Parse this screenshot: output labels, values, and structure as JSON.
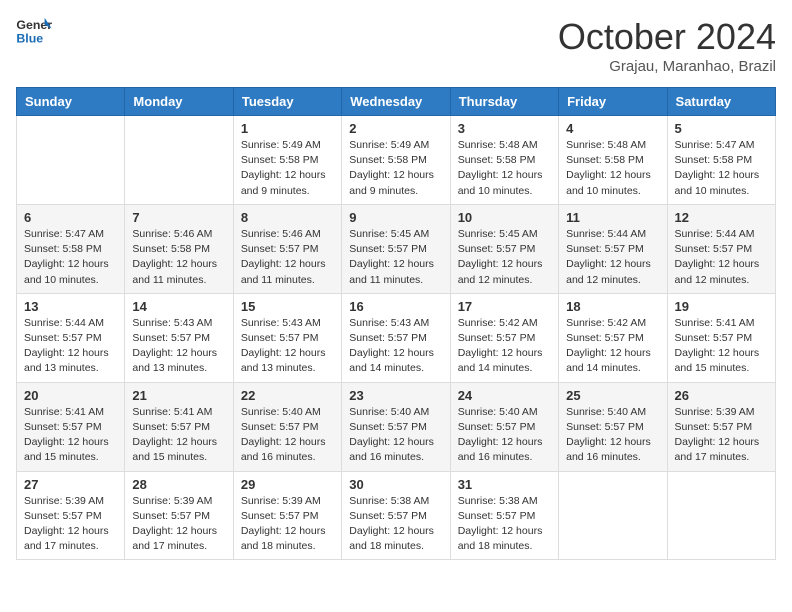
{
  "header": {
    "logo_line1": "General",
    "logo_line2": "Blue",
    "month": "October 2024",
    "location": "Grajau, Maranhao, Brazil"
  },
  "days_of_week": [
    "Sunday",
    "Monday",
    "Tuesday",
    "Wednesday",
    "Thursday",
    "Friday",
    "Saturday"
  ],
  "weeks": [
    [
      {
        "day": "",
        "info": ""
      },
      {
        "day": "",
        "info": ""
      },
      {
        "day": "1",
        "info": "Sunrise: 5:49 AM\nSunset: 5:58 PM\nDaylight: 12 hours and 9 minutes."
      },
      {
        "day": "2",
        "info": "Sunrise: 5:49 AM\nSunset: 5:58 PM\nDaylight: 12 hours and 9 minutes."
      },
      {
        "day": "3",
        "info": "Sunrise: 5:48 AM\nSunset: 5:58 PM\nDaylight: 12 hours and 10 minutes."
      },
      {
        "day": "4",
        "info": "Sunrise: 5:48 AM\nSunset: 5:58 PM\nDaylight: 12 hours and 10 minutes."
      },
      {
        "day": "5",
        "info": "Sunrise: 5:47 AM\nSunset: 5:58 PM\nDaylight: 12 hours and 10 minutes."
      }
    ],
    [
      {
        "day": "6",
        "info": "Sunrise: 5:47 AM\nSunset: 5:58 PM\nDaylight: 12 hours and 10 minutes."
      },
      {
        "day": "7",
        "info": "Sunrise: 5:46 AM\nSunset: 5:58 PM\nDaylight: 12 hours and 11 minutes."
      },
      {
        "day": "8",
        "info": "Sunrise: 5:46 AM\nSunset: 5:57 PM\nDaylight: 12 hours and 11 minutes."
      },
      {
        "day": "9",
        "info": "Sunrise: 5:45 AM\nSunset: 5:57 PM\nDaylight: 12 hours and 11 minutes."
      },
      {
        "day": "10",
        "info": "Sunrise: 5:45 AM\nSunset: 5:57 PM\nDaylight: 12 hours and 12 minutes."
      },
      {
        "day": "11",
        "info": "Sunrise: 5:44 AM\nSunset: 5:57 PM\nDaylight: 12 hours and 12 minutes."
      },
      {
        "day": "12",
        "info": "Sunrise: 5:44 AM\nSunset: 5:57 PM\nDaylight: 12 hours and 12 minutes."
      }
    ],
    [
      {
        "day": "13",
        "info": "Sunrise: 5:44 AM\nSunset: 5:57 PM\nDaylight: 12 hours and 13 minutes."
      },
      {
        "day": "14",
        "info": "Sunrise: 5:43 AM\nSunset: 5:57 PM\nDaylight: 12 hours and 13 minutes."
      },
      {
        "day": "15",
        "info": "Sunrise: 5:43 AM\nSunset: 5:57 PM\nDaylight: 12 hours and 13 minutes."
      },
      {
        "day": "16",
        "info": "Sunrise: 5:43 AM\nSunset: 5:57 PM\nDaylight: 12 hours and 14 minutes."
      },
      {
        "day": "17",
        "info": "Sunrise: 5:42 AM\nSunset: 5:57 PM\nDaylight: 12 hours and 14 minutes."
      },
      {
        "day": "18",
        "info": "Sunrise: 5:42 AM\nSunset: 5:57 PM\nDaylight: 12 hours and 14 minutes."
      },
      {
        "day": "19",
        "info": "Sunrise: 5:41 AM\nSunset: 5:57 PM\nDaylight: 12 hours and 15 minutes."
      }
    ],
    [
      {
        "day": "20",
        "info": "Sunrise: 5:41 AM\nSunset: 5:57 PM\nDaylight: 12 hours and 15 minutes."
      },
      {
        "day": "21",
        "info": "Sunrise: 5:41 AM\nSunset: 5:57 PM\nDaylight: 12 hours and 15 minutes."
      },
      {
        "day": "22",
        "info": "Sunrise: 5:40 AM\nSunset: 5:57 PM\nDaylight: 12 hours and 16 minutes."
      },
      {
        "day": "23",
        "info": "Sunrise: 5:40 AM\nSunset: 5:57 PM\nDaylight: 12 hours and 16 minutes."
      },
      {
        "day": "24",
        "info": "Sunrise: 5:40 AM\nSunset: 5:57 PM\nDaylight: 12 hours and 16 minutes."
      },
      {
        "day": "25",
        "info": "Sunrise: 5:40 AM\nSunset: 5:57 PM\nDaylight: 12 hours and 16 minutes."
      },
      {
        "day": "26",
        "info": "Sunrise: 5:39 AM\nSunset: 5:57 PM\nDaylight: 12 hours and 17 minutes."
      }
    ],
    [
      {
        "day": "27",
        "info": "Sunrise: 5:39 AM\nSunset: 5:57 PM\nDaylight: 12 hours and 17 minutes."
      },
      {
        "day": "28",
        "info": "Sunrise: 5:39 AM\nSunset: 5:57 PM\nDaylight: 12 hours and 17 minutes."
      },
      {
        "day": "29",
        "info": "Sunrise: 5:39 AM\nSunset: 5:57 PM\nDaylight: 12 hours and 18 minutes."
      },
      {
        "day": "30",
        "info": "Sunrise: 5:38 AM\nSunset: 5:57 PM\nDaylight: 12 hours and 18 minutes."
      },
      {
        "day": "31",
        "info": "Sunrise: 5:38 AM\nSunset: 5:57 PM\nDaylight: 12 hours and 18 minutes."
      },
      {
        "day": "",
        "info": ""
      },
      {
        "day": "",
        "info": ""
      }
    ]
  ]
}
